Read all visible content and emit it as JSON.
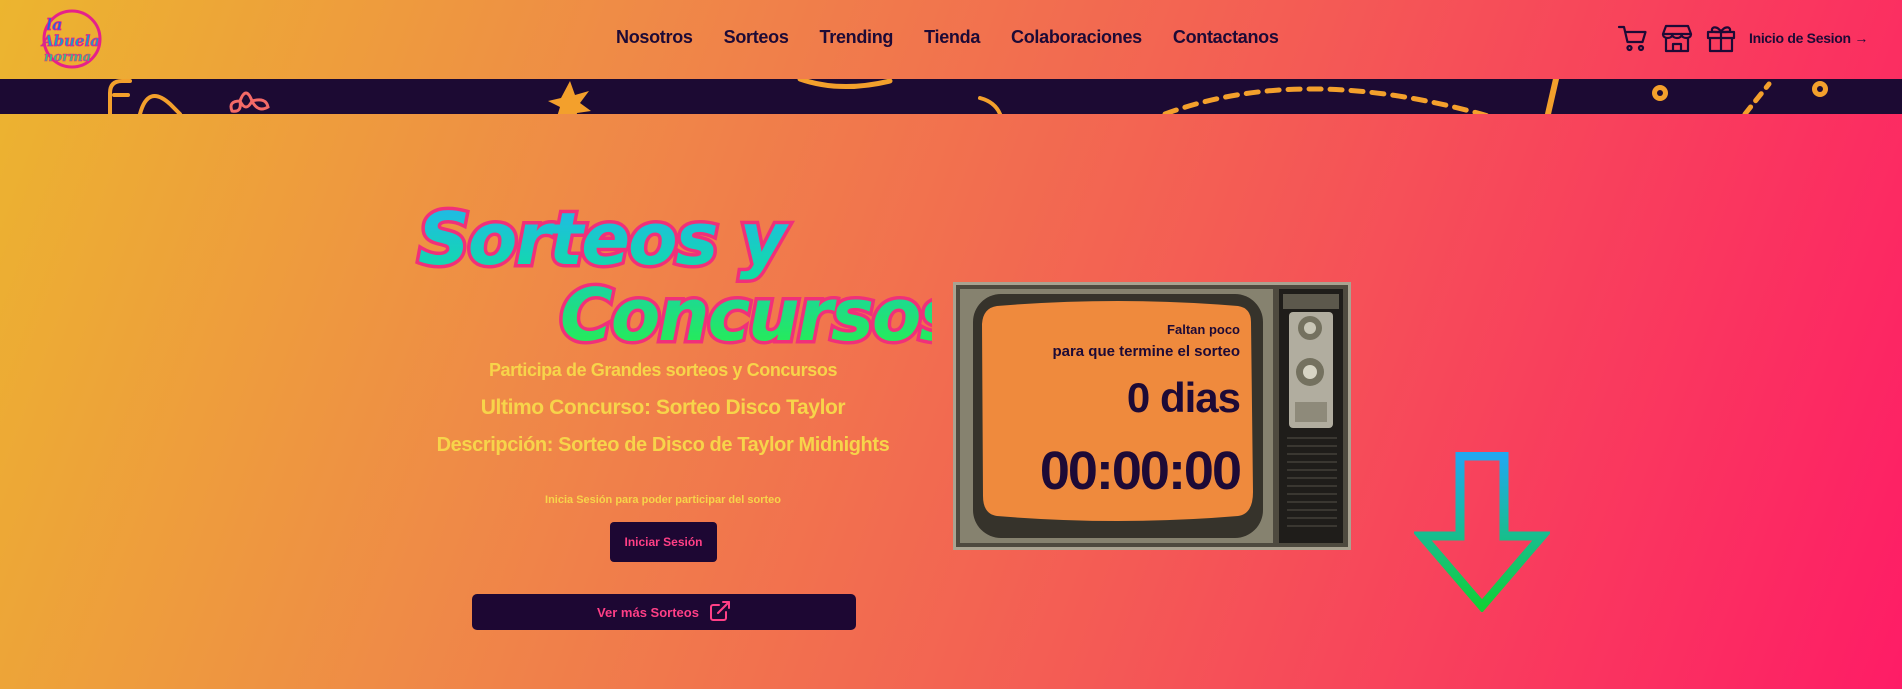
{
  "nav": {
    "logo_text": "La Abuela de la Norma",
    "menu": [
      "Nosotros",
      "Sorteos",
      "Trending",
      "Tienda",
      "Colaboraciones",
      "Contactanos"
    ],
    "icons": [
      "cart-icon",
      "store-icon",
      "gift-icon"
    ],
    "login_label": "Inicio de Sesion →"
  },
  "hero": {
    "title_line1": "Sorteos y",
    "title_line2": "Concursos",
    "subtitle": "Participa de Grandes sorteos y Concursos",
    "last_contest": "Ultimo Concurso: Sorteo Disco Taylor",
    "description": "Descripción: Sorteo de Disco de Taylor Midnights",
    "login_hint": "Inicia Sesión para poder participar del sorteo",
    "login_button": "Iniciar Sesión",
    "more_button": "Ver más Sorteos"
  },
  "countdown": {
    "line1": "Faltan poco",
    "line2": "para que termine el sorteo",
    "days": "0 dias",
    "time": "00:00:00"
  },
  "colors": {
    "dark": "#1d0a36",
    "accent_pink": "#ff3f86",
    "yellow_text": "#f7d44a",
    "title_cyan": "#22b4f0",
    "title_green": "#1ee86a"
  }
}
